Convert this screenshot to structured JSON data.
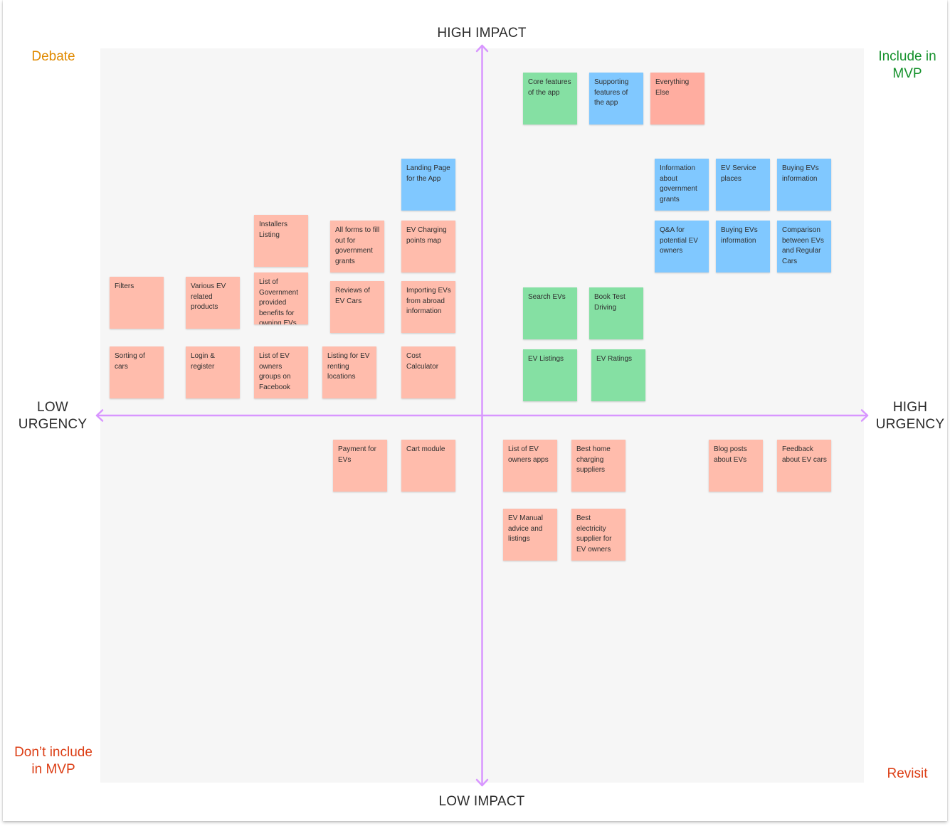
{
  "axes": {
    "top": "HIGH IMPACT",
    "bottom": "LOW IMPACT",
    "left": [
      "LOW",
      "URGENCY"
    ],
    "right": [
      "HIGH",
      "URGENCY"
    ],
    "color": "#d896ff"
  },
  "quadrants": {
    "top_left": {
      "lines": [
        "Debate"
      ],
      "color": "#e08a00"
    },
    "top_right": {
      "lines": [
        "Include in",
        "MVP"
      ],
      "color": "#14912b"
    },
    "bottom_left": {
      "lines": [
        "Don’t include",
        "in MVP"
      ],
      "color": "#dc3e15"
    },
    "bottom_right": {
      "lines": [
        "Revisit"
      ],
      "color": "#dc3e15"
    }
  },
  "colors": {
    "green": "#85e0a3",
    "blue": "#80c8ff",
    "red": "#ffbcac",
    "salmon": "#ffada0"
  },
  "legend": [
    {
      "text": "Core features of the app",
      "color": "green"
    },
    {
      "text": "Supporting features of the app",
      "color": "blue"
    },
    {
      "text": "Everything Else",
      "color": "salmon"
    }
  ],
  "stickies": [
    {
      "text": "Landing Page for the App",
      "color": "blue",
      "quadrant": "debate"
    },
    {
      "text": "Installers Listing",
      "color": "red",
      "quadrant": "debate"
    },
    {
      "text": "All forms to fill out for government grants",
      "color": "red",
      "quadrant": "debate"
    },
    {
      "text": "EV Charging points map",
      "color": "red",
      "quadrant": "debate"
    },
    {
      "text": "Filters",
      "color": "red",
      "quadrant": "debate"
    },
    {
      "text": "Various EV related products",
      "color": "red",
      "quadrant": "debate"
    },
    {
      "text": "List of Government provided benefits for owning EVs",
      "color": "red",
      "quadrant": "debate"
    },
    {
      "text": "Reviews of EV Cars",
      "color": "red",
      "quadrant": "debate"
    },
    {
      "text": "Importing EVs from abroad information",
      "color": "red",
      "quadrant": "debate"
    },
    {
      "text": "Sorting of cars",
      "color": "red",
      "quadrant": "debate"
    },
    {
      "text": "Login & register",
      "color": "red",
      "quadrant": "debate"
    },
    {
      "text": "List of EV owners groups on Facebook",
      "color": "red",
      "quadrant": "debate"
    },
    {
      "text": "Listing for EV renting locations",
      "color": "red",
      "quadrant": "debate"
    },
    {
      "text": "Cost Calculator",
      "color": "red",
      "quadrant": "debate"
    },
    {
      "text": "Information about government grants",
      "color": "blue",
      "quadrant": "include"
    },
    {
      "text": "EV Service places",
      "color": "blue",
      "quadrant": "include"
    },
    {
      "text": "Buying EVs information",
      "color": "blue",
      "quadrant": "include"
    },
    {
      "text": "Q&A for potential EV owners",
      "color": "blue",
      "quadrant": "include"
    },
    {
      "text": "Buying EVs information",
      "color": "blue",
      "quadrant": "include"
    },
    {
      "text": "Comparison between EVs and Regular Cars",
      "color": "blue",
      "quadrant": "include"
    },
    {
      "text": "Search EVs",
      "color": "green",
      "quadrant": "include"
    },
    {
      "text": "Book Test Driving",
      "color": "green",
      "quadrant": "include"
    },
    {
      "text": "EV Listings",
      "color": "green",
      "quadrant": "include"
    },
    {
      "text": "EV Ratings",
      "color": "green",
      "quadrant": "include"
    },
    {
      "text": "Payment for EVs",
      "color": "red",
      "quadrant": "dont_include"
    },
    {
      "text": "Cart module",
      "color": "red",
      "quadrant": "dont_include"
    },
    {
      "text": "List of EV owners apps",
      "color": "red",
      "quadrant": "revisit"
    },
    {
      "text": "Best home charging suppliers",
      "color": "red",
      "quadrant": "revisit"
    },
    {
      "text": "Blog posts about EVs",
      "color": "red",
      "quadrant": "revisit"
    },
    {
      "text": "Feedback about EV cars",
      "color": "red",
      "quadrant": "revisit"
    },
    {
      "text": "EV Manual advice and listings",
      "color": "red",
      "quadrant": "revisit"
    },
    {
      "text": "Best electricity supplier for EV owners",
      "color": "red",
      "quadrant": "revisit"
    }
  ]
}
